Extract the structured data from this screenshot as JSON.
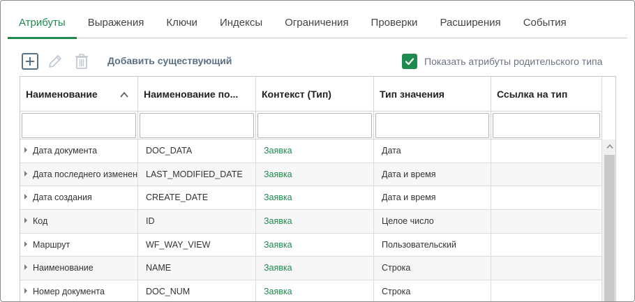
{
  "tabs": [
    {
      "label": "Атрибуты",
      "active": true
    },
    {
      "label": "Выражения"
    },
    {
      "label": "Ключи"
    },
    {
      "label": "Индексы"
    },
    {
      "label": "Ограничения"
    },
    {
      "label": "Проверки"
    },
    {
      "label": "Расширения"
    },
    {
      "label": "События"
    }
  ],
  "toolbar": {
    "add_icon": "plus-square-icon",
    "edit_icon": "pencil-icon",
    "delete_icon": "trash-icon",
    "add_existing_label": "Добавить существующий",
    "show_parent_label": "Показать атрибуты родительского типа",
    "show_parent_checked": true
  },
  "grid": {
    "columns": [
      "Наименование",
      "Наименование по...",
      "Контекст (Тип)",
      "Тип значения",
      "Ссылка на тип"
    ],
    "sort_icon": "chevron-up-icon",
    "filters": [
      "",
      "",
      "",
      "",
      ""
    ],
    "rows": [
      {
        "name": "Дата документа",
        "code": "DOC_DATA",
        "context": "Заявка",
        "type": "Дата",
        "ref": ""
      },
      {
        "name": "Дата последнего изменения",
        "code": "LAST_MODIFIED_DATE",
        "context": "Заявка",
        "type": "Дата и время",
        "ref": ""
      },
      {
        "name": "Дата создания",
        "code": "CREATE_DATE",
        "context": "Заявка",
        "type": "Дата и время",
        "ref": ""
      },
      {
        "name": "Код",
        "code": "ID",
        "context": "Заявка",
        "type": "Целое число",
        "ref": ""
      },
      {
        "name": "Маршрут",
        "code": "WF_WAY_VIEW",
        "context": "Заявка",
        "type": "Пользовательский",
        "ref": ""
      },
      {
        "name": "Наименование",
        "code": "NAME",
        "context": "Заявка",
        "type": "Строка",
        "ref": ""
      },
      {
        "name": "Номер документа",
        "code": "DOC_NUM",
        "context": "Заявка",
        "type": "Строка",
        "ref": ""
      }
    ]
  },
  "colors": {
    "accent": "#1e8a4f",
    "link": "#5b6f85"
  }
}
